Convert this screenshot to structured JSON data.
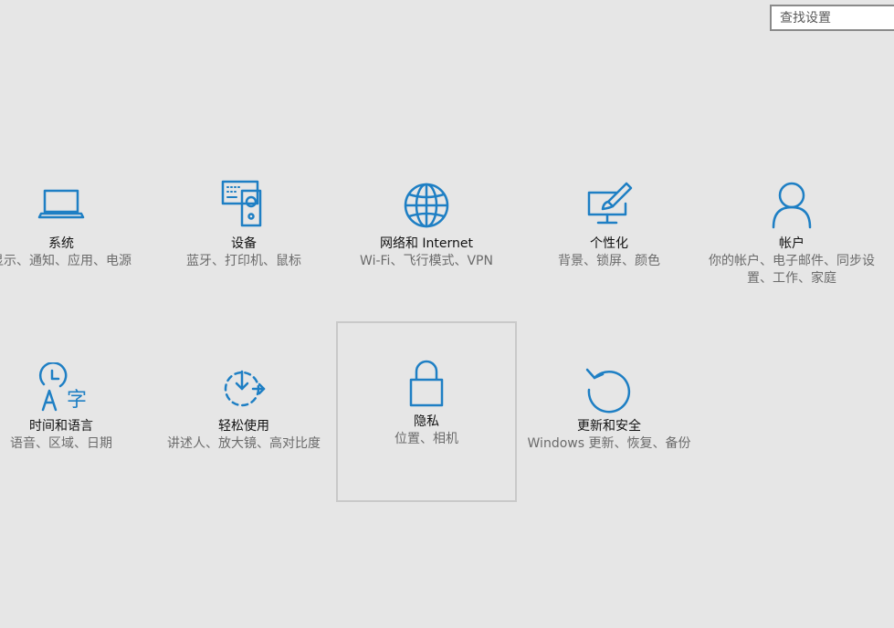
{
  "search": {
    "placeholder": "查找设置"
  },
  "accent_color": "#1e7fc4",
  "tiles": [
    {
      "icon": "laptop-icon",
      "title": "系统",
      "desc": "显示、通知、应用、电源"
    },
    {
      "icon": "keyboard-speaker-icon",
      "title": "设备",
      "desc": "蓝牙、打印机、鼠标"
    },
    {
      "icon": "globe-icon",
      "title": "网络和 Internet",
      "desc": "Wi-Fi、飞行模式、VPN"
    },
    {
      "icon": "paint-monitor-icon",
      "title": "个性化",
      "desc": "背景、锁屏、颜色"
    },
    {
      "icon": "person-icon",
      "title": "帐户",
      "desc": "你的帐户、电子邮件、同步设置、工作、家庭"
    },
    {
      "icon": "time-language-icon",
      "title": "时间和语言",
      "desc": "语音、区域、日期"
    },
    {
      "icon": "ease-of-access-icon",
      "title": "轻松使用",
      "desc": "讲述人、放大镜、高对比度"
    },
    {
      "icon": "lock-icon",
      "title": "隐私",
      "desc": "位置、相机"
    },
    {
      "icon": "update-refresh-icon",
      "title": "更新和安全",
      "desc": "Windows 更新、恢复、备份"
    }
  ]
}
